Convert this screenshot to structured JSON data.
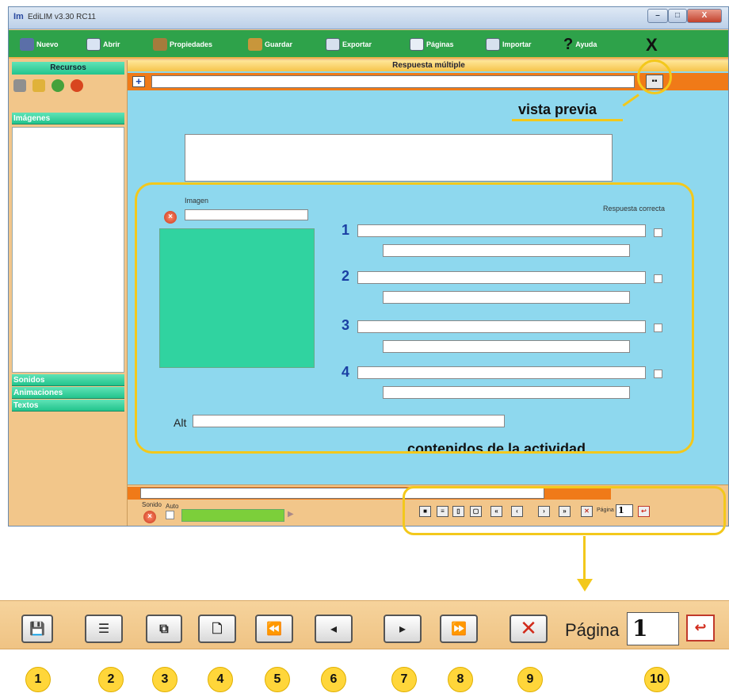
{
  "window": {
    "title": "EdiLIM v3.30 RC11",
    "min": "–",
    "max": "□",
    "close": "X"
  },
  "toolbar": {
    "items": [
      "Nuevo",
      "Abrir",
      "Propiedades",
      "Guardar",
      "Exportar",
      "Páginas",
      "Importar",
      "Ayuda"
    ],
    "close": "X"
  },
  "sidebar": {
    "title": "Recursos",
    "sections": [
      "Imágenes",
      "Sonidos",
      "Animaciones",
      "Textos"
    ]
  },
  "main": {
    "title": "Respuesta múltiple",
    "image_label": "Imagen",
    "correct_label": "Respuesta correcta",
    "answers": [
      "1",
      "2",
      "3",
      "4"
    ],
    "alt_label": "Alt"
  },
  "sound": {
    "label": "Sonido",
    "auto": "Auto"
  },
  "nav_small": {
    "page_label": "Página",
    "page_value": "1"
  },
  "callouts": {
    "preview": "vista previa",
    "content": "contenidos de la actividad"
  },
  "zoom": {
    "page_label": "Página",
    "page_value": "1",
    "numbers": [
      "1",
      "2",
      "3",
      "4",
      "5",
      "6",
      "7",
      "8",
      "9",
      "10"
    ]
  }
}
